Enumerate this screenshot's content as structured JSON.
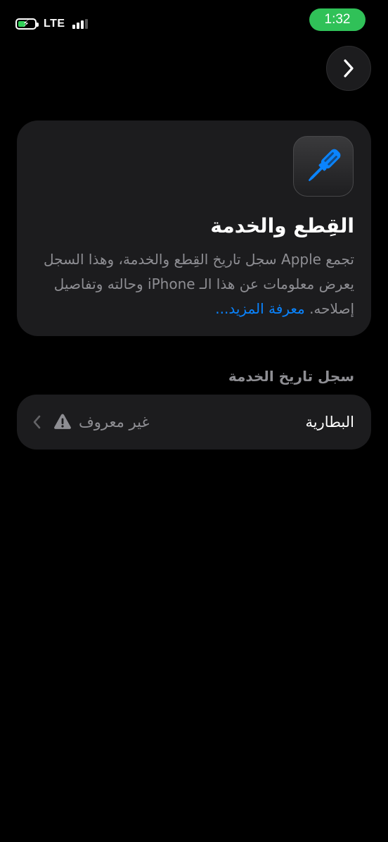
{
  "status_bar": {
    "network": "LTE",
    "time": "1:32",
    "battery_charging": true
  },
  "nav": {
    "back_icon": "chevron-right-icon"
  },
  "info_card": {
    "icon": "screwdriver-icon",
    "icon_color": "#0a84ff",
    "title": "القِطع والخدمة",
    "description": "تجمع Apple سجل تاريخ القِطع والخدمة، وهذا السجل يعرض معلومات عن هذا الـ iPhone وحالته وتفاصيل إصلاحه.",
    "learn_more": "معرفة المزيد..."
  },
  "service_history": {
    "header": "سجل تاريخ الخدمة",
    "rows": [
      {
        "label": "البطارية",
        "value": "غير معروف",
        "status_icon": "warning-icon"
      }
    ]
  },
  "colors": {
    "background": "#000000",
    "card": "#1c1c1e",
    "accent": "#0a84ff",
    "clock_pill": "#30c158",
    "secondary_text": "#8e8e93"
  }
}
